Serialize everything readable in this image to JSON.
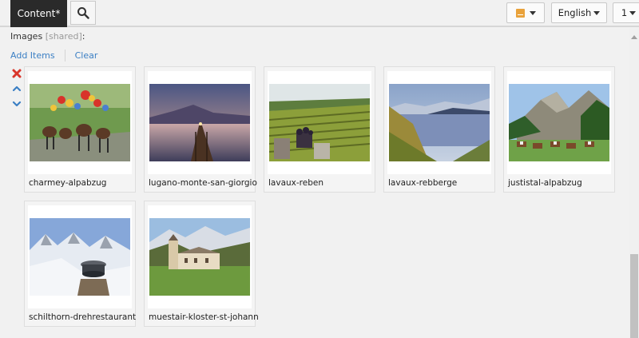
{
  "topbar": {
    "tab_label": "Content*",
    "search_icon": "search-icon",
    "language": "English",
    "number": "1"
  },
  "field": {
    "label": "Images",
    "shared": "[shared]",
    "colon": ":"
  },
  "actions": {
    "add_items": "Add Items",
    "clear": "Clear"
  },
  "tools": [
    "remove-icon",
    "move-up-icon",
    "move-down-icon"
  ],
  "items": [
    {
      "name": "charmey-alpabzug"
    },
    {
      "name": "lugano-monte-san-giorgio"
    },
    {
      "name": "lavaux-reben"
    },
    {
      "name": "lavaux-rebberge"
    },
    {
      "name": "justistal-alpabzug"
    },
    {
      "name": "schilthorn-drehrestaurant"
    },
    {
      "name": "muestair-kloster-st-johann"
    }
  ],
  "colors": {
    "accent": "#3b7fc4",
    "remove": "#d9362b",
    "tab_bg": "#2a2a2a"
  }
}
